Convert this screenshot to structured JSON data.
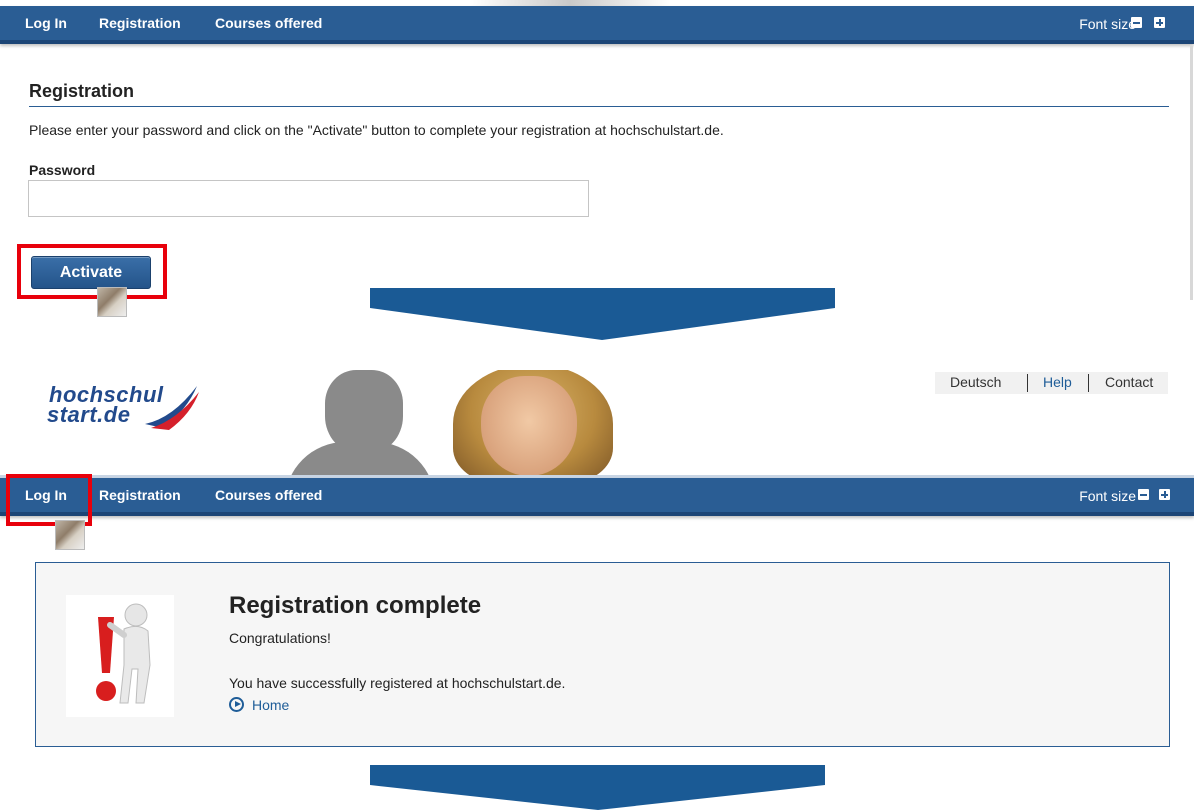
{
  "top_nav": {
    "items": [
      "Log In",
      "Registration",
      "Courses offered"
    ],
    "font_size_label": "Font size"
  },
  "registration": {
    "title": "Registration",
    "instruction": "Please enter your password and click on the \"Activate\" button to complete your registration at hochschulstart.de.",
    "password_label": "Password",
    "password_value": "",
    "activate_label": "Activate"
  },
  "site_header": {
    "logo_line1": "hochschul",
    "logo_line2": "start.de",
    "links": [
      "Deutsch",
      "Help",
      "Contact"
    ],
    "link_colors": {
      "Deutsch": "#333333",
      "Help": "#1f5d98",
      "Contact": "#333333"
    }
  },
  "bottom_nav": {
    "items": [
      "Log In",
      "Registration",
      "Courses offered"
    ],
    "font_size_label": "Font size"
  },
  "completion": {
    "title": "Registration complete",
    "congrats": "Congratulations!",
    "message": "You have successfully registered at hochschulstart.de.",
    "home_link": "Home"
  },
  "colors": {
    "nav_bar": "#2a5d94",
    "arrow": "#1a5a95",
    "highlight_box": "#e8000b",
    "logo": "#224a8c"
  }
}
